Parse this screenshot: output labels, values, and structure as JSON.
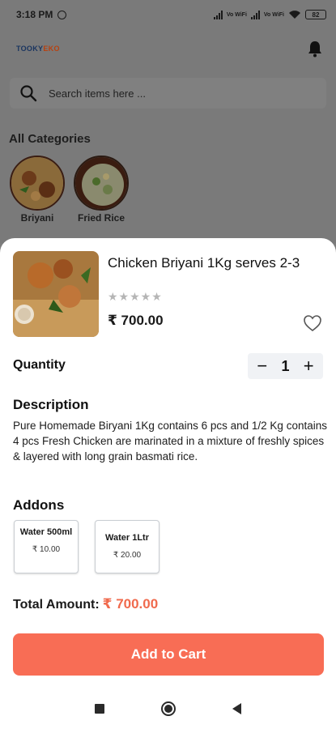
{
  "status_bar": {
    "time": "3:18 PM",
    "battery": "82",
    "volte1": "Vo WiFi",
    "volte2": "Vo WiFi"
  },
  "header": {
    "logo_part1": "TOOKY",
    "logo_part2": "EKO",
    "bell_icon": "bell-icon"
  },
  "search": {
    "placeholder": "Search items here ..."
  },
  "categories": {
    "title": "All Categories",
    "items": [
      {
        "label": "Briyani"
      },
      {
        "label": "Fried Rice"
      }
    ]
  },
  "product": {
    "name": "Chicken Briyani 1Kg serves 2-3",
    "stars": "★★★★★",
    "rating": 0,
    "price": "₹ 700.00"
  },
  "quantity": {
    "label": "Quantity",
    "value": "1",
    "minus": "−",
    "plus": "+"
  },
  "description": {
    "title": "Description",
    "text": "Pure Homemade Biryani 1Kg contains 6 pcs and 1/2 Kg contains 4 pcs Fresh Chicken are marinated in a mixture of freshly spices & layered with long grain basmati rice."
  },
  "addons": {
    "title": "Addons",
    "items": [
      {
        "name": "Water 500ml",
        "price": "₹ 10.00"
      },
      {
        "name": "Water 1Ltr",
        "price": "₹ 20.00"
      }
    ]
  },
  "total": {
    "label": "Total Amount:",
    "value": "₹ 700.00"
  },
  "cart_button": {
    "label": "Add to Cart"
  },
  "colors": {
    "accent": "#f86d55",
    "price_accent": "#f06a4d",
    "overlay": "#7d7d7d"
  }
}
